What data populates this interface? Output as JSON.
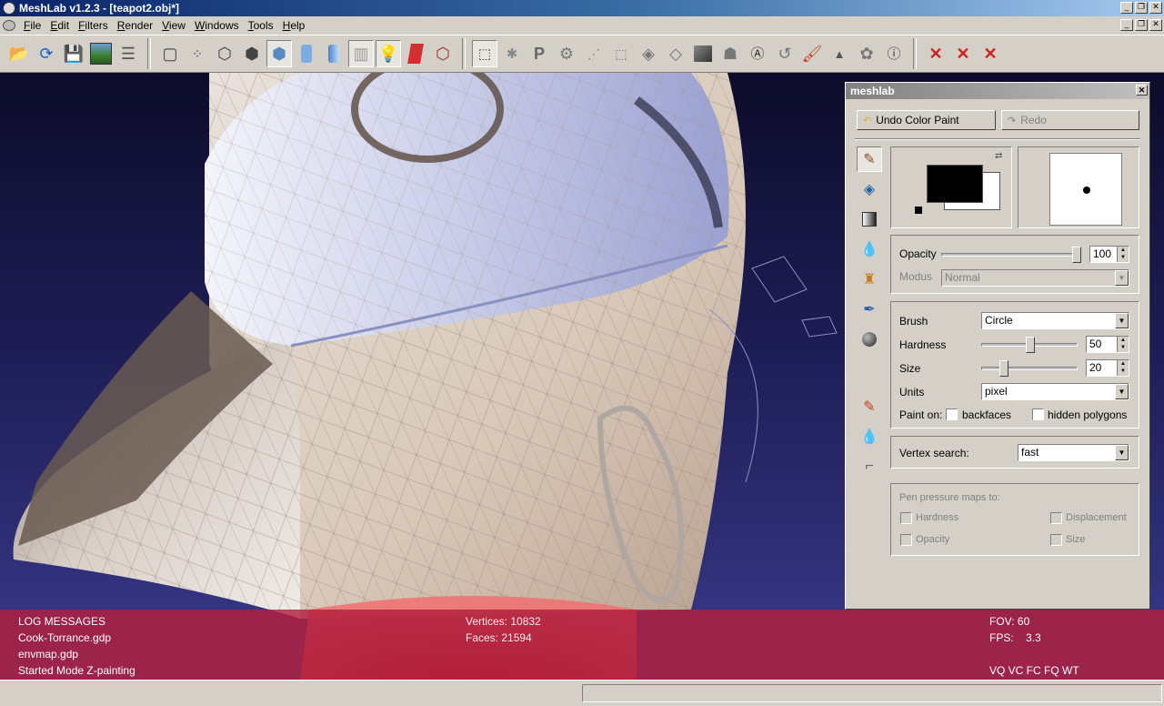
{
  "window": {
    "title": "MeshLab v1.2.3 - [teapot2.obj*]"
  },
  "menu": [
    "File",
    "Edit",
    "Filters",
    "Render",
    "View",
    "Windows",
    "Tools",
    "Help"
  ],
  "toolbar": {
    "file_tools": [
      "open-folder-icon",
      "reload-icon",
      "save-icon",
      "snapshot-icon",
      "layers-icon"
    ],
    "render_tools": [
      "bbox-icon",
      "points-icon",
      "wireframe-icon",
      "hidden-lines-icon",
      "flat-lines-icon",
      "flat-icon",
      "smooth-icon",
      "texture-icon",
      "light-icon",
      "double-side-light-icon",
      "fancy-light-icon"
    ],
    "edit_tools": [
      "select-icon",
      "edit-pickpoints-icon",
      "edit-paint-icon",
      "edit-align-icon",
      "select-vertex-icon",
      "select-connected-icon",
      "select-region-icon",
      "select-faces-icon",
      "edit-texture-icon",
      "edit-measure-icon",
      "edit-label-icon",
      "edit-arc-icon",
      "edit-brush-icon",
      "edit-rgb-icon",
      "edit-geometry-icon",
      "edit-spot-icon",
      "info-icon"
    ],
    "delete_tools": [
      "delete-faces-icon",
      "delete-vertices-icon",
      "delete-selection-icon"
    ]
  },
  "log": {
    "header": "LOG MESSAGES",
    "lines": [
      "Cook-Torrance.gdp",
      "envmap.gdp",
      "Started Mode Z-painting"
    ],
    "vertices": "Vertices: 10832",
    "faces": "Faces: 21594",
    "fov": "FOV: 60",
    "fps": "FPS:    3.3",
    "flags": "VQ VC FC FQ WT"
  },
  "dock": {
    "title": "meshlab",
    "undo_label": "Undo Color Paint",
    "redo_label": "Redo",
    "opacity": {
      "label": "Opacity",
      "value": "100"
    },
    "modus": {
      "label": "Modus",
      "value": "Normal"
    },
    "brush": {
      "label": "Brush",
      "value": "Circle"
    },
    "hardness": {
      "label": "Hardness",
      "value": "50"
    },
    "size": {
      "label": "Size",
      "value": "20"
    },
    "units": {
      "label": "Units",
      "value": "pixel"
    },
    "paint_on": {
      "label": "Paint on:",
      "backfaces": "backfaces",
      "hidden": "hidden polygons"
    },
    "vertex_search": {
      "label": "Vertex search:",
      "value": "fast"
    },
    "pen_pressure": {
      "label": "Pen pressure maps to:",
      "hardness": "Hardness",
      "displacement": "Displacement",
      "opacity": "Opacity",
      "size": "Size"
    },
    "tools": [
      "pen-icon",
      "fill-icon",
      "gradient-icon",
      "smudge-icon",
      "clone-icon",
      "picker-icon",
      "noise-icon",
      "mesh-paint-icon",
      "mesh-smooth-icon",
      "mesh-pull-icon"
    ],
    "foreground_color": "#000000",
    "background_color": "#ffffff"
  }
}
